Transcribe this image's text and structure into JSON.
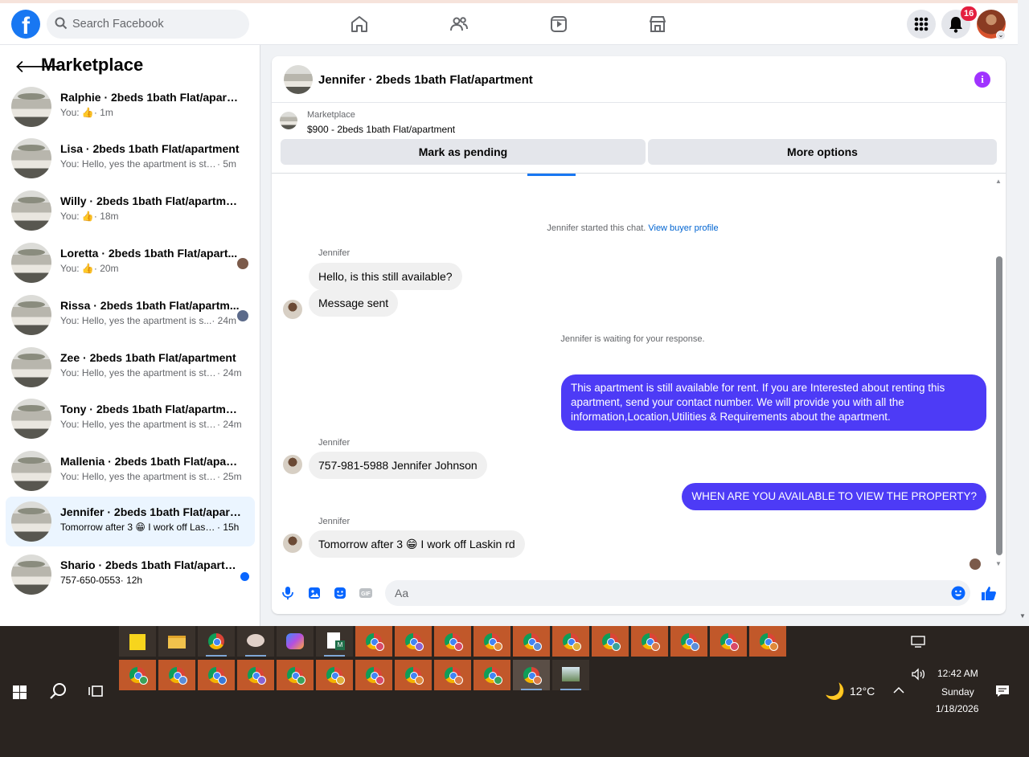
{
  "topbar": {
    "search_placeholder": "Search Facebook",
    "notification_count": "16",
    "logo_letter": "f"
  },
  "sidebar": {
    "title": "Marketplace",
    "conversations": [
      {
        "name": "Ralphie · 2beds 1bath Flat/apartm...",
        "preview": "You: 👍",
        "time": " · 1m"
      },
      {
        "name": "Lisa · 2beds 1bath Flat/apartment",
        "preview": "You: Hello, yes the apartment is still a...",
        "time": " · 5m"
      },
      {
        "name": "Willy · 2beds 1bath Flat/apartment",
        "preview": "You: 👍",
        "time": " · 18m"
      },
      {
        "name": "Loretta · 2beds 1bath Flat/apart...",
        "preview": "You: 👍",
        "time": " · 20m"
      },
      {
        "name": "Rissa · 2beds 1bath Flat/apartm...",
        "preview": "You: Hello, yes the apartment is s...",
        "time": " · 24m"
      },
      {
        "name": "Zee · 2beds 1bath Flat/apartment",
        "preview": "You: Hello, yes the apartment is still ...",
        "time": " · 24m"
      },
      {
        "name": "Tony · 2beds 1bath Flat/apartment",
        "preview": "You: Hello, yes the apartment is still ...",
        "time": " · 24m"
      },
      {
        "name": "Mallenia · 2beds 1bath Flat/apart...",
        "preview": "You: Hello, yes the apartment is still ...",
        "time": " · 25m"
      },
      {
        "name": "Jennifer · 2beds 1bath Flat/apartm...",
        "preview": "Tomorrow after 3 😁 I work off Laski...",
        "time": " · 15h"
      },
      {
        "name": "Shario · 2beds 1bath Flat/apartm...",
        "preview": "757-650-0553",
        "time": " · 12h"
      }
    ]
  },
  "chat": {
    "title": "Jennifer · 2beds 1bath Flat/apartment",
    "listing_label": "Marketplace",
    "listing_price": "$900 - 2beds 1bath Flat/apartment",
    "mark_pending": "Mark as pending",
    "more_options": "More options",
    "started_text": "Jennifer started this chat. ",
    "view_profile": "View buyer profile",
    "waiting_text": "Jennifer is waiting for your response.",
    "sender_name": "Jennifer",
    "msg1": "Hello, is this still available?",
    "msg2": "Message sent",
    "msg3": "This apartment is still available for rent. If you are Interested about renting this apartment, send your contact number. We will provide you with all the information,Location,Utilities & Requirements about the apartment.",
    "msg4": "757-981-5988 Jennifer Johnson",
    "msg5": "WHEN ARE YOU AVAILABLE TO VIEW THE PROPERTY?",
    "msg6": "Tomorrow after 3 😁 I work off Laskin rd",
    "composer_placeholder": "Aa"
  },
  "taskbar": {
    "weather": "12°C",
    "time": "12:42 AM",
    "day": "Sunday",
    "date": "1/18/2026"
  },
  "colors": {
    "facebook_blue": "#1877f2",
    "outgoing_bubble": "#4d3bf6",
    "badge_red": "#e41e3f",
    "taskbar_orange": "#c1582a"
  }
}
